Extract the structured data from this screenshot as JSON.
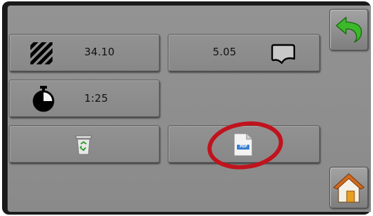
{
  "tiles": {
    "area": {
      "icon": "hatched-area-icon",
      "value": "34.10"
    },
    "distance": {
      "icon": "field-outline-icon",
      "value": "5.05"
    },
    "time": {
      "icon": "stopwatch-icon",
      "value": "1:25"
    },
    "reset": {
      "icon": "recycle-bin-icon"
    },
    "report": {
      "icon": "pdf-document-icon",
      "label": "PDF"
    }
  },
  "sidebar": {
    "back": {
      "icon": "back-arrow-icon"
    },
    "home": {
      "icon": "home-icon"
    }
  },
  "annotation": {
    "color": "#c0131d"
  },
  "colors": {
    "panel": "#8e8e8e",
    "frame": "#1a1a1a",
    "back_arrow": "#3cb92a",
    "home_roof": "#d2691e"
  }
}
